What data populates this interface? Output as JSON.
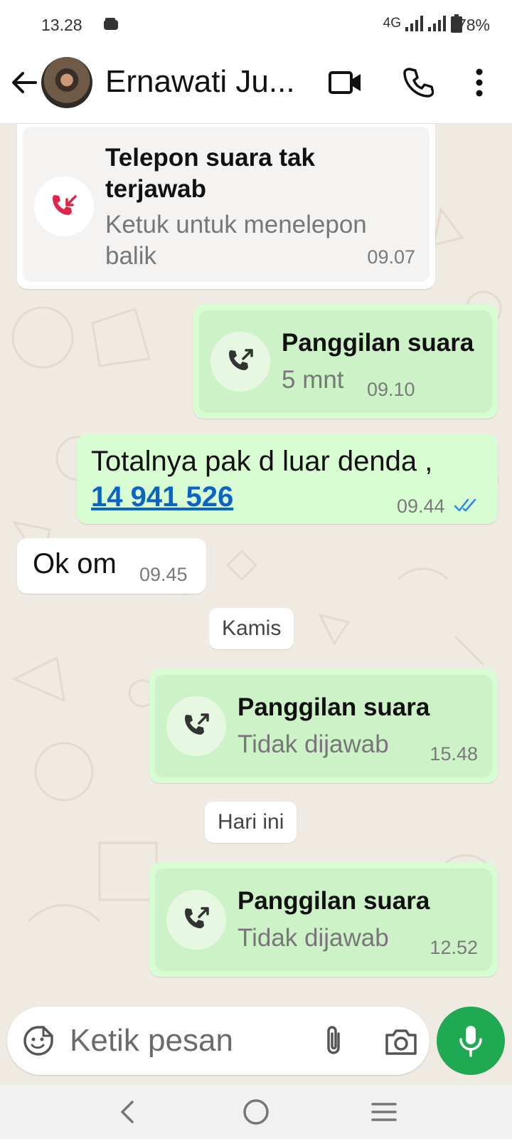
{
  "status_bar": {
    "time": "13.28",
    "network": "4G",
    "battery": "78%"
  },
  "header": {
    "contact_name": "Ernawati Ju..."
  },
  "messages": [
    {
      "direction": "in",
      "type": "call",
      "title_line1": "Telepon suara tak",
      "title_line2": "terjawab",
      "subtitle_line1": "Ketuk untuk menelepon",
      "subtitle_line2": "balik",
      "time": "09.07",
      "icon": "missed-call-icon"
    },
    {
      "direction": "out",
      "type": "call",
      "title": "Panggilan suara",
      "subtitle": "5 mnt",
      "time": "09.10",
      "icon": "outgoing-call-icon"
    },
    {
      "direction": "out",
      "type": "text",
      "text": "Totalnya pak d luar denda ,",
      "link": "14 941 526",
      "time": "09.44",
      "status": "read"
    },
    {
      "direction": "in",
      "type": "text",
      "text": "Ok om",
      "time": "09.45"
    },
    {
      "direction": "out",
      "type": "call",
      "title": "Panggilan suara",
      "subtitle": "Tidak dijawab",
      "time": "15.48",
      "icon": "outgoing-call-icon"
    },
    {
      "direction": "out",
      "type": "call",
      "title": "Panggilan suara",
      "subtitle": "Tidak dijawab",
      "time": "12.52",
      "icon": "outgoing-call-icon"
    }
  ],
  "date_separators": [
    "Kamis",
    "Hari ini"
  ],
  "composer": {
    "placeholder": "Ketik pesan"
  },
  "colors": {
    "outgoing_bubble": "#d9fdd3",
    "incoming_bubble": "#ffffff",
    "accent_green": "#1ea952",
    "missed_call_red": "#e0244a",
    "read_tick_blue": "#2f8ae8",
    "link_blue": "#0b63c5"
  }
}
